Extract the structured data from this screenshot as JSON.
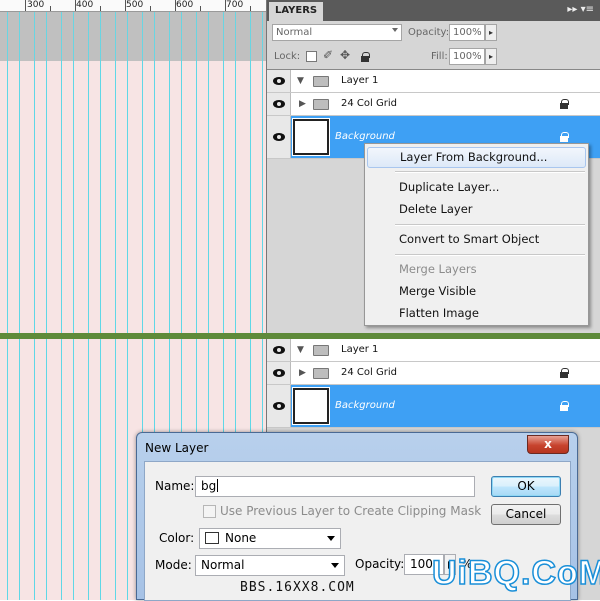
{
  "ruler": {
    "labels": [
      "300",
      "400",
      "500",
      "600",
      "700"
    ]
  },
  "layers_panel": {
    "tab": "LAYERS",
    "controls": "▸▸ ▾≡",
    "blend_mode": "Normal",
    "opacity_label": "Opacity:",
    "opacity_value": "100%",
    "lock_label": "Lock:",
    "fill_label": "Fill:",
    "fill_value": "100%",
    "layers": [
      {
        "name": "Layer 1"
      },
      {
        "name": "24 Col Grid"
      },
      {
        "name": "Background"
      }
    ]
  },
  "context_menu": {
    "items": [
      "Layer From Background...",
      "Duplicate Layer...",
      "Delete Layer",
      "Convert to Smart Object",
      "Merge Layers",
      "Merge Visible",
      "Flatten Image"
    ]
  },
  "dialog": {
    "title": "New Layer",
    "close": "x",
    "name_label": "Name:",
    "name_value": "bg",
    "clip_label": "Use Previous Layer to Create Clipping Mask",
    "color_label": "Color:",
    "color_value": "None",
    "mode_label": "Mode:",
    "mode_value": "Normal",
    "opacity_label": "Opacity:",
    "opacity_value": "100",
    "opacity_unit": "%",
    "ok": "OK",
    "cancel": "Cancel"
  },
  "watermarks": {
    "bbs": "BBS.16XX8.COM",
    "site": "UiBQ.CoM"
  },
  "colors": {
    "selection": "#3ea0f4",
    "guide": "#5fd7e6",
    "divider": "#5e8a3a",
    "canvas": "#f7e4e4"
  }
}
